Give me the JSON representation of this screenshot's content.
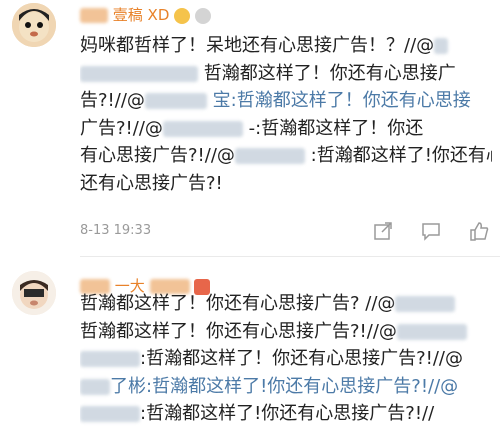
{
  "comments": [
    {
      "username": "壹稿 XD",
      "lines": [
        "妈咪都哲样了！呆地还有心思接广告！？//@",
        "哲瀚都这样了！你还有心思接广",
        "告?!//@",
        "宝:哲瀚都这样了！你还有心思接",
        "广告?!//@",
        "-:哲瀚都这样了！你还",
        "有心思接广告?!//@",
        ":哲瀚都这样了!你还有心思接广告?!你",
        "还有心思接广告?!"
      ],
      "timestamp": "8-13 19:33"
    },
    {
      "username": "一大",
      "lines": [
        "哲瀚都这样了！你还有心思接广告? //@",
        "哲瀚都这样了！你还有心思接广告?!//@",
        ":哲瀚都这样了！你还有心思接广告?!//@",
        "了彬:哲瀚都这样了!你还有心思接广告?!//@",
        ":哲瀚都这样了!你还有心思接广告?!//"
      ]
    }
  ],
  "colors": {
    "username": "#e8822a",
    "mention": "#4c7aa7",
    "meta": "#9a9a9a"
  },
  "icons": [
    "share-icon",
    "comment-icon",
    "like-icon"
  ]
}
